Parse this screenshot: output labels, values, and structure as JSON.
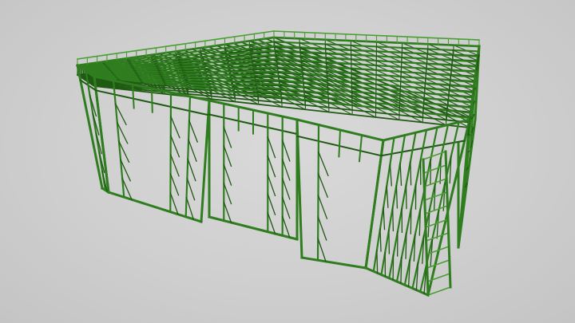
{
  "scene": {
    "subject": "steel-frame-structure",
    "colors": {
      "background": "#cfcfcf",
      "frame": "#2f7d1f",
      "frame_dark": "#1e5a12",
      "frame_light": "#4a9e33"
    }
  }
}
